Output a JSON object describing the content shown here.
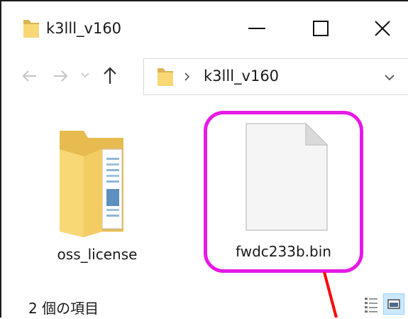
{
  "window": {
    "title": "k3lll_v160"
  },
  "title_bar": {
    "minimize_icon": "minimize-icon",
    "maximize_icon": "maximize-icon",
    "close_icon": "close-icon"
  },
  "navigation": {
    "back_icon": "arrow-left-icon",
    "forward_icon": "arrow-right-icon",
    "recent_icon": "chevron-down-icon",
    "up_icon": "arrow-up-icon"
  },
  "address_bar": {
    "path": "k3lll_v160",
    "separator_icon": "chevron-right-icon",
    "dropdown_icon": "chevron-down-icon"
  },
  "items": [
    {
      "name": "oss_license",
      "type": "folder",
      "icon": "folder-icon"
    },
    {
      "name": "fwdc233b.bin",
      "type": "file",
      "icon": "file-icon",
      "highlighted": true
    }
  ],
  "status_bar": {
    "item_count": "2 個の項目"
  },
  "colors": {
    "highlight": "#e619e6",
    "arrow": "#ff0000",
    "folder": "#f8d775"
  }
}
